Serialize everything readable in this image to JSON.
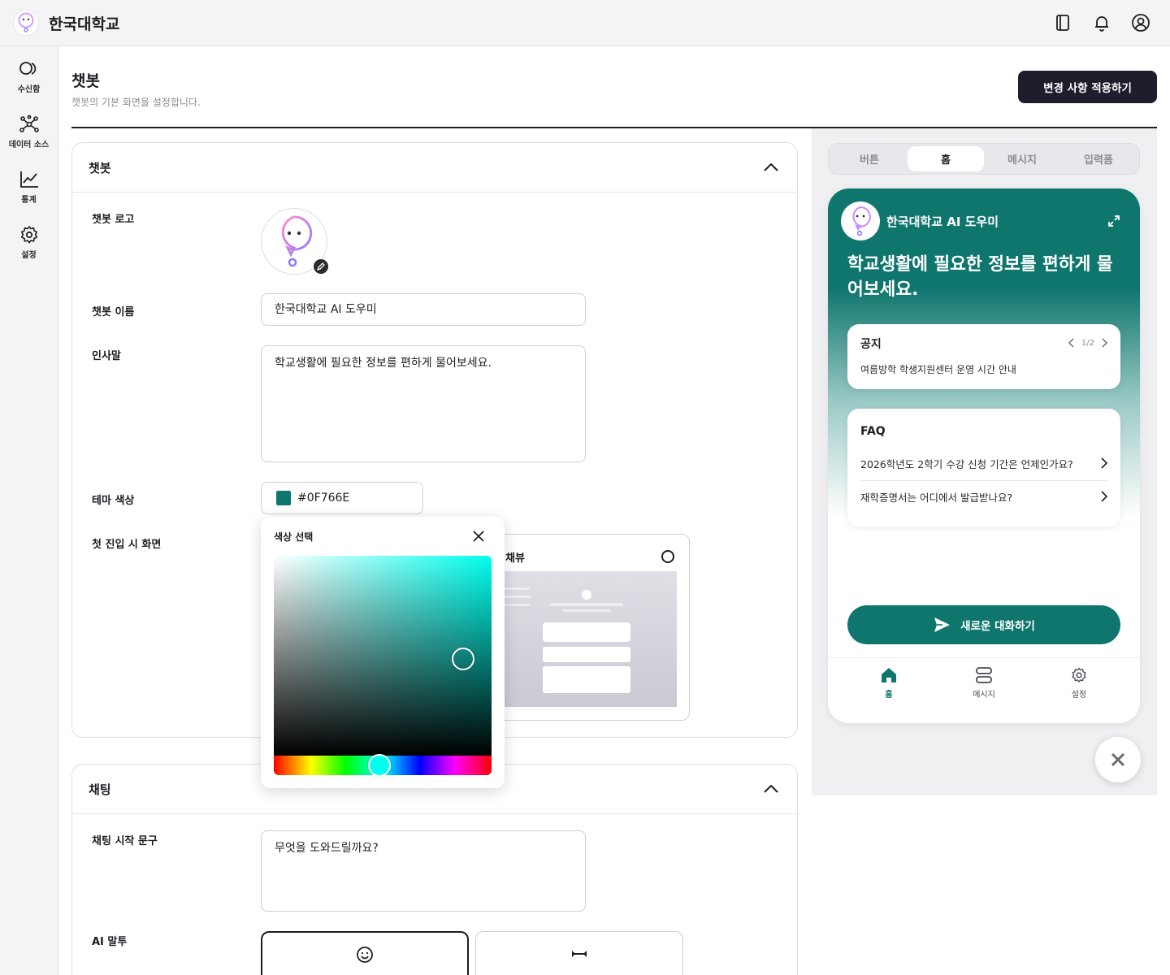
{
  "header": {
    "org_name": "한국대학교",
    "icons": [
      "book-icon",
      "bell-icon",
      "user-circle-icon"
    ]
  },
  "sidebar": {
    "items": [
      {
        "label": "수신함",
        "icon": "chat-bubbles-icon"
      },
      {
        "label": "데이터 소스",
        "icon": "network-icon"
      },
      {
        "label": "통계",
        "icon": "line-chart-icon"
      },
      {
        "label": "설정",
        "icon": "gear-icon"
      }
    ]
  },
  "page": {
    "title": "챗봇",
    "subtitle": "챗봇의 기본 화면을 설정합니다.",
    "apply_button": "변경 사항 적용하기"
  },
  "chatbot_section": {
    "title": "챗봇",
    "logo_label": "챗봇 로고",
    "name_label": "챗봇 이름",
    "name_value": "한국대학교 AI 도우미",
    "greeting_label": "인사말",
    "greeting_value": "학교생활에 필요한 정보를 편하게 물어보세요.",
    "theme_label": "테마 색상",
    "theme_value": "#0F766E",
    "first_screen_label": "첫 진입 시 화면",
    "layout_option_title": "채뷰"
  },
  "color_picker": {
    "title": "색상 선택",
    "selected_color": "#0F766E",
    "hue_color": "#00FFF0"
  },
  "chat_section": {
    "title": "채팅",
    "start_label": "채팅 시작 문구",
    "start_value": "무엇을 도와드릴까요?",
    "tone_label": "AI 말투"
  },
  "preview": {
    "tabs": [
      "버튼",
      "홈",
      "메시지",
      "입력폼"
    ],
    "active_tab": "홈",
    "widget": {
      "name": "한국대학교 AI 도우미",
      "greeting": "학교생활에 필요한 정보를 편하게 물어보세요.",
      "notice_title": "공지",
      "notice_page": "1/2",
      "notice_text": "여름방학 학생지원센터 운영 시간 안내",
      "faq_title": "FAQ",
      "faq_items": [
        "2026학년도 2학기 수강 신청 기간은 언제인가요?",
        "재학증명서는 어디에서 발급받나요?"
      ],
      "new_chat": "새로운 대화하기",
      "nav": [
        {
          "label": "홈",
          "icon": "home-icon"
        },
        {
          "label": "메시지",
          "icon": "messages-icon"
        },
        {
          "label": "설정",
          "icon": "gear-icon"
        }
      ]
    }
  },
  "colors": {
    "theme": "#0F766E",
    "dark_button": "#1D1D2C"
  }
}
